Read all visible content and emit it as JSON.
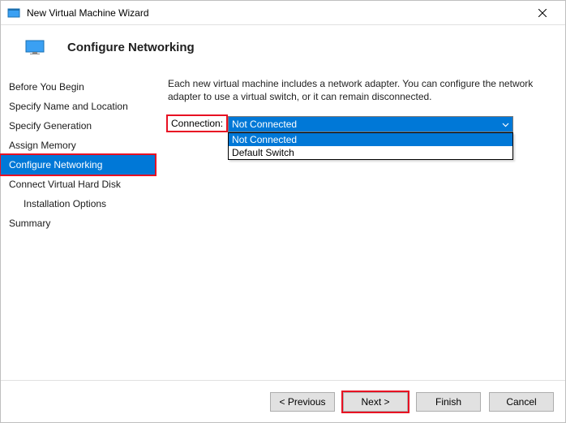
{
  "window": {
    "title": "New Virtual Machine Wizard"
  },
  "header": {
    "page_title": "Configure Networking"
  },
  "sidebar": {
    "steps": [
      {
        "label": "Before You Begin"
      },
      {
        "label": "Specify Name and Location"
      },
      {
        "label": "Specify Generation"
      },
      {
        "label": "Assign Memory"
      },
      {
        "label": "Configure Networking"
      },
      {
        "label": "Connect Virtual Hard Disk"
      },
      {
        "label": "Installation Options"
      },
      {
        "label": "Summary"
      }
    ]
  },
  "content": {
    "description": "Each new virtual machine includes a network adapter. You can configure the network adapter to use a virtual switch, or it can remain disconnected.",
    "connection_label": "Connection:",
    "connection_selected": "Not Connected",
    "connection_options": [
      "Not Connected",
      "Default Switch"
    ]
  },
  "footer": {
    "previous": "< Previous",
    "next": "Next >",
    "finish": "Finish",
    "cancel": "Cancel"
  },
  "colors": {
    "accent": "#0078d7",
    "highlight": "#e81123"
  }
}
